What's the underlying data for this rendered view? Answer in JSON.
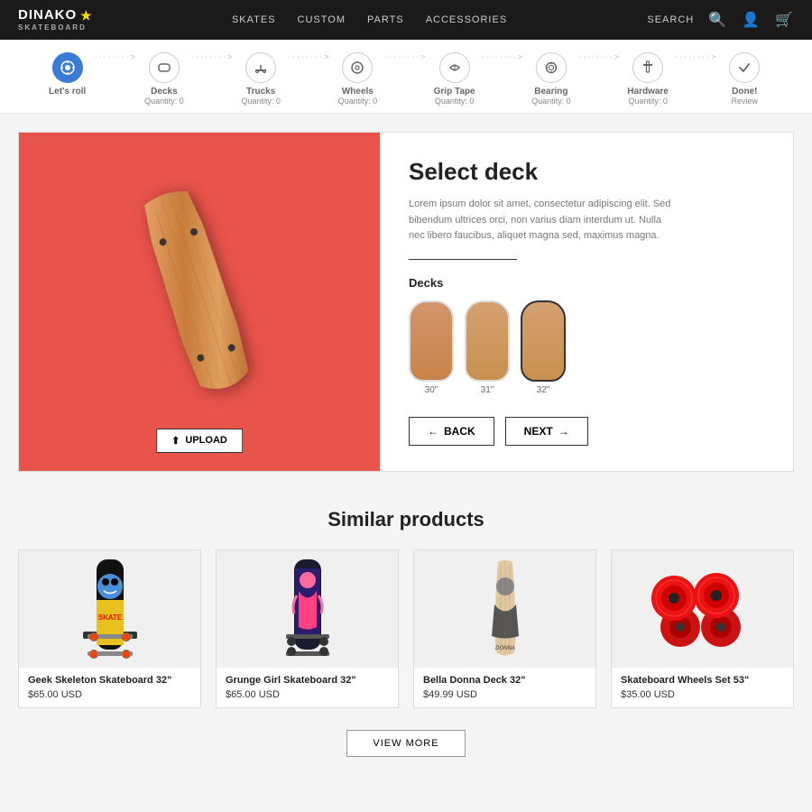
{
  "navbar": {
    "brand": "DINAKO",
    "sub": "SKATEBOARD",
    "star": "★",
    "links": [
      "SKATES",
      "CUSTOM",
      "PARTS",
      "ACCESSORIES"
    ],
    "search_label": "SEARCH",
    "icons": [
      "search",
      "user",
      "cart"
    ]
  },
  "steps": [
    {
      "id": "lets-roll",
      "label": "Let's roll",
      "icon": "⚙",
      "active": true,
      "qty": ""
    },
    {
      "id": "decks",
      "label": "Decks",
      "icon": "🏂",
      "active": false,
      "qty": "Quantity: 0"
    },
    {
      "id": "trucks",
      "label": "Trucks",
      "icon": "🔧",
      "active": false,
      "qty": "Quantity: 0"
    },
    {
      "id": "wheels",
      "label": "Wheels",
      "icon": "⭕",
      "active": false,
      "qty": "Quantity: 0"
    },
    {
      "id": "grip-tape",
      "label": "Grip Tape",
      "icon": "📎",
      "active": false,
      "qty": "Quantity: 0"
    },
    {
      "id": "bearing",
      "label": "Bearing",
      "icon": "⚙",
      "active": false,
      "qty": "Quantity: 0"
    },
    {
      "id": "hardware",
      "label": "Hardware",
      "icon": "🔩",
      "active": false,
      "qty": "Quantity: 0"
    },
    {
      "id": "done",
      "label": "Done!",
      "icon": "✏",
      "active": false,
      "qty": "Review"
    }
  ],
  "product_panel": {
    "title": "Select deck",
    "description": "Lorem ipsum dolor sit amet, consectetur adipiscing elit. Sed bibendum ultrices orci, non varius diam interdum ut. Nulla nec libero faucibus, aliquet magna sed, maximus magna.",
    "section_label": "Decks",
    "deck_options": [
      {
        "size": "30\"",
        "selected": false
      },
      {
        "size": "31\"",
        "selected": false
      },
      {
        "size": "32\"",
        "selected": true
      }
    ],
    "upload_label": "UPLOAD",
    "back_label": "← BACK",
    "next_label": "NEXT →"
  },
  "similar_products": {
    "title": "Similar products",
    "view_more_label": "VIEW MORE",
    "products": [
      {
        "name": "Geek Skeleton Skateboard 32\"",
        "price": "$65.00 USD",
        "type": "skateboard-colorful"
      },
      {
        "name": "Grunge Girl Skateboard 32\"",
        "price": "$65.00 USD",
        "type": "skateboard-dark"
      },
      {
        "name": "Bella Donna Deck 32\"",
        "price": "$49.99 USD",
        "type": "skateboard-plain"
      },
      {
        "name": "Skateboard Wheels Set 53\"",
        "price": "$35.00 USD",
        "type": "wheels"
      }
    ]
  }
}
